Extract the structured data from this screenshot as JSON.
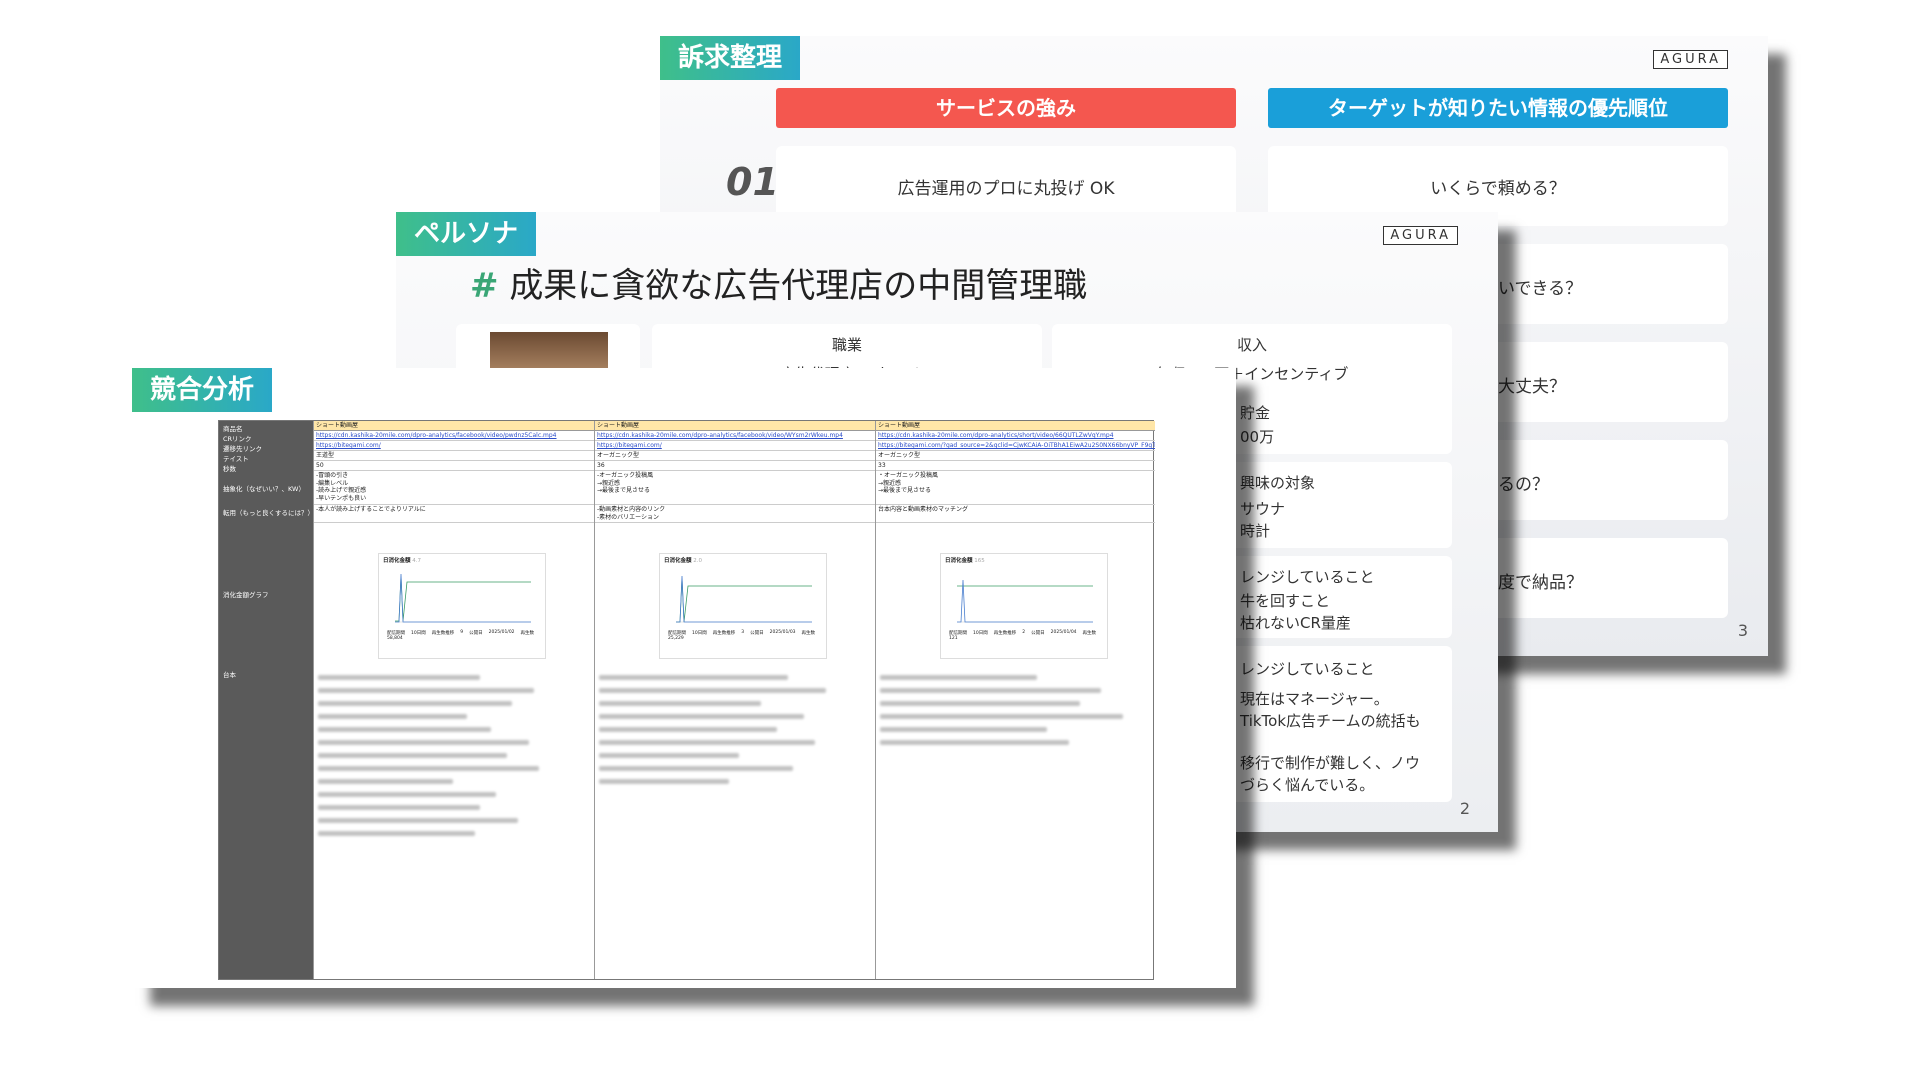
{
  "slide3": {
    "tag": "訴求整理",
    "logo": "AGURA",
    "header_left": "サービスの強み",
    "header_right": "ターゲットが知りたい情報の優先順位",
    "number": "01",
    "left_card": "広告運用のプロに丸投げ OK",
    "right_cards": [
      "いくらで頼める？",
      "いできる？",
      "大丈夫？",
      "るの？",
      "度で納品？"
    ],
    "page": "3",
    "colors": {
      "left_header": "#f4574f",
      "right_header": "#1a9fd9"
    }
  },
  "slide2": {
    "tag": "ペルソナ",
    "logo": "AGURA",
    "title_hash": "#",
    "title": "成果に貪欲な広告代理店の中間管理職",
    "job_label": "職業",
    "job_value": "WEB広告代理店/マネージャー",
    "income_label": "収入",
    "income_value": "年収800万＋インセンティブ",
    "savings_label": "貯金",
    "savings_value": "00万",
    "interest_label": "興味の対象",
    "interest_items": [
      "サウナ",
      "時計"
    ],
    "challenge1_label": "レンジしていること",
    "challenge1_lines": [
      "牛を回すこと",
      "枯れないCR量産"
    ],
    "challenge2_label": "レンジしていること",
    "challenge2_lines": [
      "現在はマネージャー。",
      "TikTok広告チームの統括も",
      "",
      "移行で制作が難しく、ノウ",
      "づらく悩んでいる。"
    ],
    "page": "2"
  },
  "slide1": {
    "tag": "競合分析",
    "row_labels": [
      "商品名",
      "CRリンク",
      "遷移先リンク",
      "テイスト",
      "秒数",
      "抽象化（なぜいい？、KW）",
      "転用（もっと良くするには？）",
      "消化金額グラフ",
      "台本"
    ],
    "columns": [
      {
        "name": "ショート動画屋",
        "cr_link": "https://cdn.kashika-20mile.com/dpro-analytics/facebook/video/pwdnz5Calc.mp4",
        "lp_link": "https://bitegami.com/",
        "taste": "王道型",
        "seconds": "50",
        "abstract": [
          "-冒頭の引き",
          "-編集レベル",
          "-読み上げで親近感",
          "-早いテンポも良い"
        ],
        "transfer": "-本人が読み上げすることでよりリアルに",
        "graph_title": "日消化金額",
        "graph_value": "4.7",
        "stats": [
          "配信期間",
          "10日間",
          "再生数推移",
          "9",
          "公開日",
          "2025/01/02",
          "再生数",
          "58,804"
        ]
      },
      {
        "name": "ショート動画屋",
        "cr_link": "https://cdn.kashika-20mile.com/dpro-analytics/facebook/video/WYsm2rWkeu.mp4",
        "lp_link": "https://bitegami.com/",
        "taste": "オーガニック型",
        "seconds": "36",
        "abstract": [
          "-オーガニック投稿風",
          "→親近感",
          "→最後まで見させる"
        ],
        "transfer": [
          "-動画素材と内容のリンク",
          "-素材のバリエーション"
        ],
        "graph_title": "日消化金額",
        "graph_value": "2.0",
        "stats": [
          "配信期間",
          "10日間",
          "再生数推移",
          "3",
          "公開日",
          "2025/01/03",
          "再生数",
          "25,229"
        ]
      },
      {
        "name": "ショート動画屋",
        "cr_link": "https://cdn.kashika-20mile.com/dpro-analytics/short/video/66QUTLZwVqY.mp4",
        "lp_link": "https://bitegami.com/?gad_source=2&gclid=CjwKCAiA-OiTBhA1EiwA2u2S0NX66bnyVP_F9gT",
        "taste": "オーガニック型",
        "seconds": "33",
        "abstract": [
          "・オーガニック投稿風",
          "→親近感",
          "→最後まで見させる"
        ],
        "transfer": "台本内容と動画素材のマッチング",
        "graph_title": "日消化金額",
        "graph_value": "165",
        "stats": [
          "配信期間",
          "10日間",
          "再生数推移",
          "2",
          "公開日",
          "2025/01/04",
          "再生数",
          "121"
        ]
      }
    ],
    "colors": {
      "sidebar": "#5a5a5a",
      "header": "#ffe6a8",
      "link": "#2d4ec9",
      "line": "#3a9b64"
    }
  }
}
